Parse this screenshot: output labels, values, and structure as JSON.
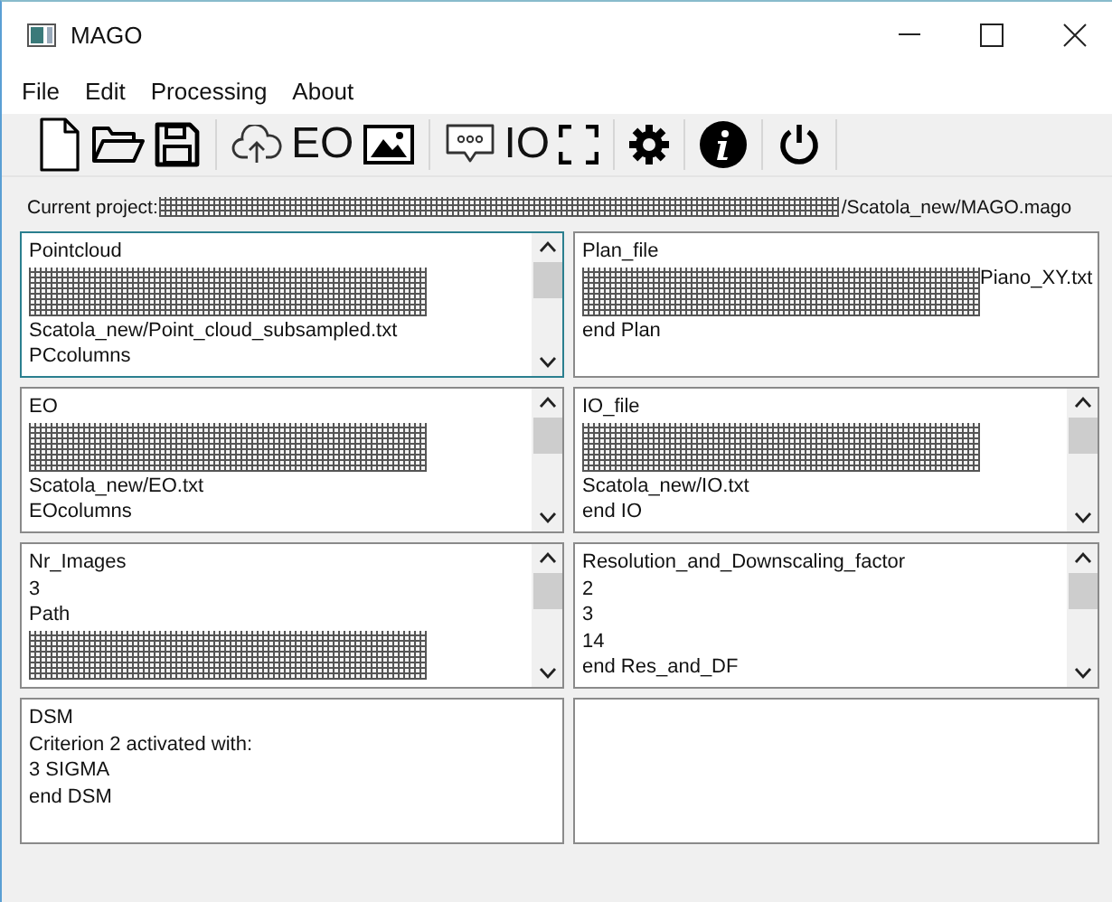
{
  "window": {
    "title": "MAGO"
  },
  "menu": [
    "File",
    "Edit",
    "Processing",
    "About"
  ],
  "toolbar": {
    "eo_label": "EO",
    "io_label": "IO"
  },
  "project": {
    "label": "Current project:",
    "path_suffix": "/Scatola_new/MAGO.mago"
  },
  "panels": [
    {
      "focused": true,
      "scrollbar": true,
      "lines": [
        {
          "kind": "text",
          "text": "Pointcloud"
        },
        {
          "kind": "redacted"
        },
        {
          "kind": "text",
          "text": "Scatola_new/Point_cloud_subsampled.txt"
        },
        {
          "kind": "text",
          "text": "PCcolumns"
        }
      ]
    },
    {
      "focused": false,
      "scrollbar": false,
      "lines": [
        {
          "kind": "text",
          "text": "Plan_file"
        },
        {
          "kind": "redacted_text",
          "text": "Piano_XY.txt"
        },
        {
          "kind": "text",
          "text": "end Plan"
        }
      ]
    },
    {
      "focused": false,
      "scrollbar": true,
      "lines": [
        {
          "kind": "text",
          "text": "EO"
        },
        {
          "kind": "redacted"
        },
        {
          "kind": "text",
          "text": "Scatola_new/EO.txt"
        },
        {
          "kind": "text",
          "text": "EOcolumns"
        }
      ]
    },
    {
      "focused": false,
      "scrollbar": true,
      "lines": [
        {
          "kind": "text",
          "text": "IO_file"
        },
        {
          "kind": "redacted"
        },
        {
          "kind": "text",
          "text": "Scatola_new/IO.txt"
        },
        {
          "kind": "text",
          "text": "end IO"
        }
      ]
    },
    {
      "focused": false,
      "scrollbar": true,
      "lines": [
        {
          "kind": "text",
          "text": "Nr_Images"
        },
        {
          "kind": "text",
          "text": "3"
        },
        {
          "kind": "text",
          "text": "Path"
        },
        {
          "kind": "redacted"
        }
      ]
    },
    {
      "focused": false,
      "scrollbar": true,
      "lines": [
        {
          "kind": "text",
          "text": "Resolution_and_Downscaling_factor"
        },
        {
          "kind": "text",
          "text": "2"
        },
        {
          "kind": "text",
          "text": "3"
        },
        {
          "kind": "text",
          "text": "14"
        },
        {
          "kind": "text",
          "text": "end Res_and_DF"
        }
      ]
    },
    {
      "focused": false,
      "scrollbar": false,
      "lines": [
        {
          "kind": "text",
          "text": "DSM"
        },
        {
          "kind": "text",
          "text": "Criterion 2 activated with:"
        },
        {
          "kind": "text",
          "text": "3 SIGMA"
        },
        {
          "kind": "text",
          "text": "end DSM"
        }
      ]
    },
    {
      "focused": false,
      "scrollbar": false
    }
  ]
}
